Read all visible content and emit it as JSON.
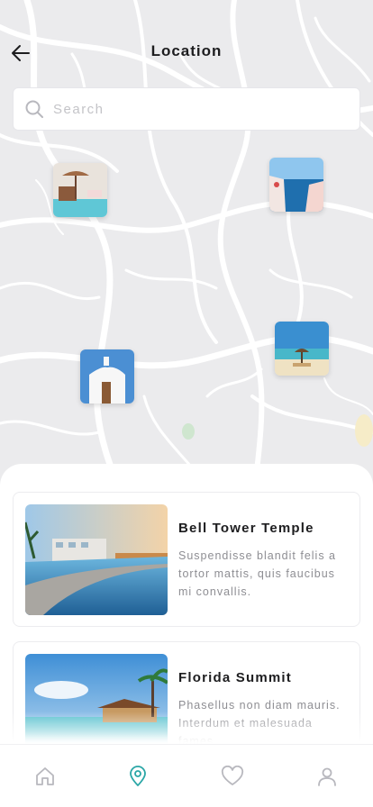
{
  "header": {
    "title": "Location",
    "back_icon": "arrow-left-icon"
  },
  "search": {
    "placeholder": "Search",
    "value": "",
    "icon": "search-icon"
  },
  "map": {
    "pins": [
      "resort-pool",
      "santorini-cliff",
      "beach-umbrellas",
      "white-chapel"
    ]
  },
  "places": [
    {
      "name": "Bell Tower Temple",
      "description": "Suspendisse blandit felis a tortor mattis, quis faucibus mi convallis."
    },
    {
      "name": "Florida Summit",
      "description": "Phasellus non diam mauris. Interdum et malesuada fames."
    }
  ],
  "tabbar": {
    "tabs": [
      {
        "icon": "home-icon",
        "active": false
      },
      {
        "icon": "location-pin-icon",
        "active": true
      },
      {
        "icon": "heart-icon",
        "active": false
      },
      {
        "icon": "user-icon",
        "active": false
      }
    ],
    "active_color": "#2aa6a6",
    "inactive_color": "#b8b8be"
  },
  "colors": {
    "accent": "#2aa6a6",
    "map_bg": "#ebebed",
    "road": "#ffffff"
  }
}
